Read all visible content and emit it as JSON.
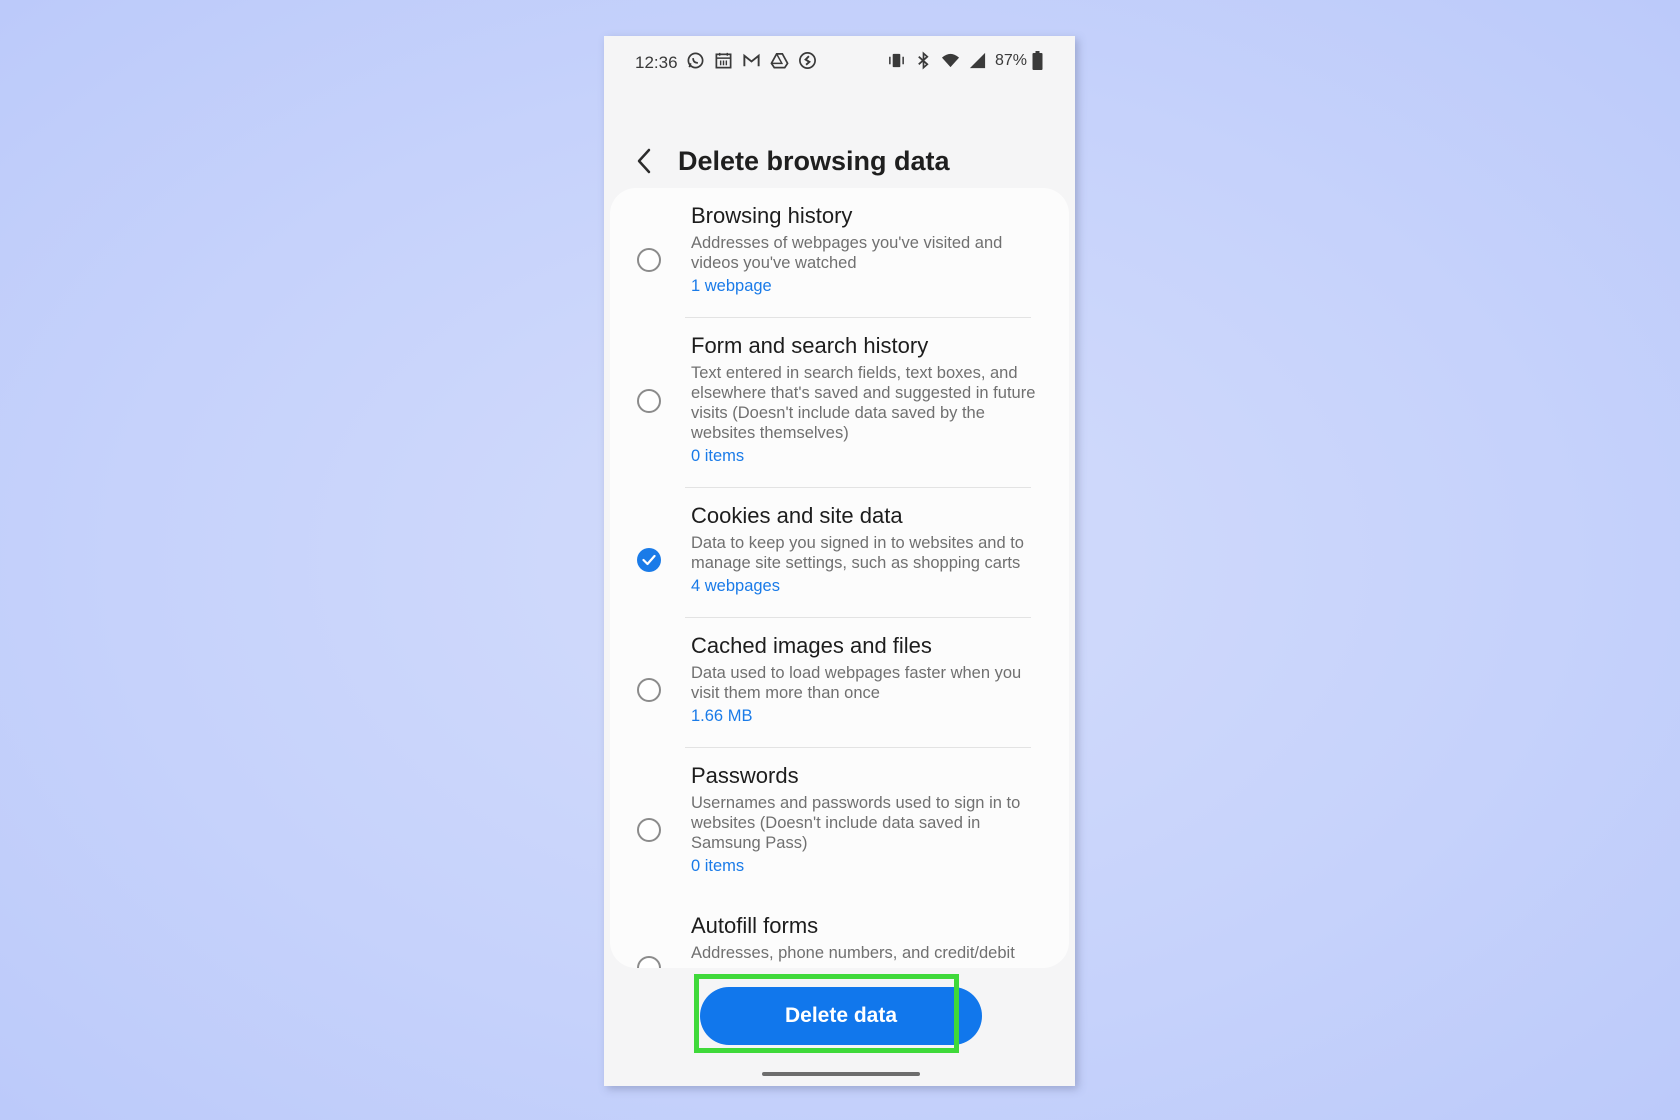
{
  "status_bar": {
    "time": "12:36",
    "battery_percent": "87%",
    "left_icons": [
      "whatsapp-icon",
      "calendar-icon",
      "gmail-icon",
      "drive-icon",
      "shazam-icon"
    ],
    "right_icons": [
      "vibrate-icon",
      "bluetooth-icon",
      "wifi-icon",
      "signal-icon",
      "battery-icon"
    ]
  },
  "header": {
    "title": "Delete browsing data"
  },
  "items": [
    {
      "label": "Browsing history",
      "description": "Addresses of webpages you've visited and videos you've watched",
      "count": "1 webpage",
      "checked": false
    },
    {
      "label": "Form and search history",
      "description": "Text entered in search fields, text boxes, and elsewhere that's saved and suggested in future visits (Doesn't include data saved by the websites themselves)",
      "count": "0 items",
      "checked": false
    },
    {
      "label": "Cookies and site data",
      "description": "Data to keep you signed in to websites and to manage site settings, such as shopping carts",
      "count": "4 webpages",
      "checked": true
    },
    {
      "label": "Cached images and files",
      "description": "Data used to load webpages faster when you visit them more than once",
      "count": "1.66 MB",
      "checked": false
    },
    {
      "label": "Passwords",
      "description": "Usernames and passwords used to sign in to websites (Doesn't include data saved in Samsung Pass)",
      "count": "0 items",
      "checked": false
    },
    {
      "label": "Autofill forms",
      "description": "Addresses, phone numbers, and credit/debit",
      "count": "",
      "checked": false
    }
  ],
  "footer": {
    "delete_label": "Delete data"
  },
  "colors": {
    "accent": "#1a7be8",
    "highlight": "#3fd93a",
    "background": "#c6d2fb"
  }
}
